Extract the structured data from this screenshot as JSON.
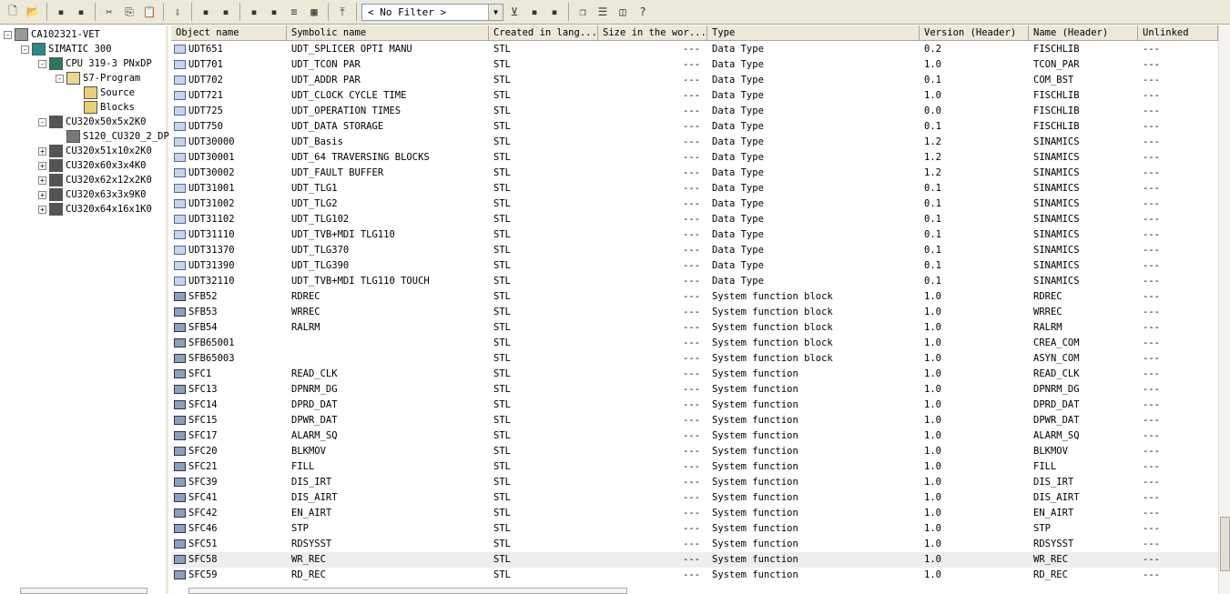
{
  "toolbar": {
    "filter_value": "< No Filter >",
    "icons": [
      "new-icon",
      "open-icon",
      "accessible-nodes-icon",
      "memory-card-icon",
      "cut-icon",
      "copy-icon",
      "paste-icon",
      "download-icon",
      "online-icon",
      "offline-icon",
      "large-icons-icon",
      "small-icons-icon",
      "list-icon",
      "details-icon",
      "up-level-icon",
      "filter-icon",
      "netpro-icon",
      "simulation-icon",
      "cascade-icon",
      "tile-horizontal-icon",
      "tile-vertical-icon",
      "help-icon"
    ]
  },
  "tree": [
    {
      "label": "CA102321-VET",
      "level": 0,
      "expander": "-",
      "icon": "project-icon"
    },
    {
      "label": "SIMATIC 300",
      "level": 1,
      "expander": "-",
      "icon": "station-icon"
    },
    {
      "label": "CPU 319-3 PNxDP",
      "level": 2,
      "expander": "-",
      "icon": "cpu-icon"
    },
    {
      "label": "S7-Program",
      "level": 3,
      "expander": "-",
      "icon": "program-folder-icon"
    },
    {
      "label": "Source",
      "level": 4,
      "expander": "",
      "icon": "source-folder-icon"
    },
    {
      "label": "Blocks",
      "level": 4,
      "expander": "",
      "icon": "blocks-folder-icon"
    },
    {
      "label": "CU320x50x5x2K0",
      "level": 2,
      "expander": "-",
      "icon": "drive-icon"
    },
    {
      "label": "S120_CU320_2_DP",
      "level": 3,
      "expander": "",
      "icon": "drive-object-icon"
    },
    {
      "label": "CU320x51x10x2K0",
      "level": 2,
      "expander": "+",
      "icon": "drive-icon"
    },
    {
      "label": "CU320x60x3x4K0",
      "level": 2,
      "expander": "+",
      "icon": "drive-icon"
    },
    {
      "label": "CU320x62x12x2K0",
      "level": 2,
      "expander": "+",
      "icon": "drive-icon"
    },
    {
      "label": "CU320x63x3x9K0",
      "level": 2,
      "expander": "+",
      "icon": "drive-icon"
    },
    {
      "label": "CU320x64x16x1K0",
      "level": 2,
      "expander": "+",
      "icon": "drive-icon"
    }
  ],
  "columns": [
    "Object name",
    "Symbolic name",
    "Created in lang...",
    "Size in the wor...",
    "Type",
    "Version (Header)",
    "Name (Header)",
    "Unlinked"
  ],
  "rows": [
    [
      "UDT651",
      "UDT_SPLICER OPTI MANU",
      "STL",
      "---",
      "Data Type",
      "0.2",
      "FISCHLIB",
      "---"
    ],
    [
      "UDT701",
      "UDT_TCON PAR",
      "STL",
      "---",
      "Data Type",
      "1.0",
      "TCON_PAR",
      "---"
    ],
    [
      "UDT702",
      "UDT_ADDR PAR",
      "STL",
      "---",
      "Data Type",
      "0.1",
      "COM_BST",
      "---"
    ],
    [
      "UDT721",
      "UDT_CLOCK CYCLE TIME",
      "STL",
      "---",
      "Data Type",
      "1.0",
      "FISCHLIB",
      "---"
    ],
    [
      "UDT725",
      "UDT_OPERATION TIMES",
      "STL",
      "---",
      "Data Type",
      "0.0",
      "FISCHLIB",
      "---"
    ],
    [
      "UDT750",
      "UDT_DATA STORAGE",
      "STL",
      "---",
      "Data Type",
      "0.1",
      "FISCHLIB",
      "---"
    ],
    [
      "UDT30000",
      "UDT_Basis",
      "STL",
      "---",
      "Data Type",
      "1.2",
      "SINAMICS",
      "---"
    ],
    [
      "UDT30001",
      "UDT_64 TRAVERSING BLOCKS",
      "STL",
      "---",
      "Data Type",
      "1.2",
      "SINAMICS",
      "---"
    ],
    [
      "UDT30002",
      "UDT_FAULT BUFFER",
      "STL",
      "---",
      "Data Type",
      "1.2",
      "SINAMICS",
      "---"
    ],
    [
      "UDT31001",
      "UDT_TLG1",
      "STL",
      "---",
      "Data Type",
      "0.1",
      "SINAMICS",
      "---"
    ],
    [
      "UDT31002",
      "UDT_TLG2",
      "STL",
      "---",
      "Data Type",
      "0.1",
      "SINAMICS",
      "---"
    ],
    [
      "UDT31102",
      "UDT_TLG102",
      "STL",
      "---",
      "Data Type",
      "0.1",
      "SINAMICS",
      "---"
    ],
    [
      "UDT31110",
      "UDT_TVB+MDI TLG110",
      "STL",
      "---",
      "Data Type",
      "0.1",
      "SINAMICS",
      "---"
    ],
    [
      "UDT31370",
      "UDT_TLG370",
      "STL",
      "---",
      "Data Type",
      "0.1",
      "SINAMICS",
      "---"
    ],
    [
      "UDT31390",
      "UDT_TLG390",
      "STL",
      "---",
      "Data Type",
      "0.1",
      "SINAMICS",
      "---"
    ],
    [
      "UDT32110",
      "UDT_TVB+MDI TLG110 TOUCH",
      "STL",
      "---",
      "Data Type",
      "0.1",
      "SINAMICS",
      "---"
    ],
    [
      "SFB52",
      "RDREC",
      "STL",
      "---",
      "System function block",
      "1.0",
      "RDREC",
      "---"
    ],
    [
      "SFB53",
      "WRREC",
      "STL",
      "---",
      "System function block",
      "1.0",
      "WRREC",
      "---"
    ],
    [
      "SFB54",
      "RALRM",
      "STL",
      "---",
      "System function block",
      "1.0",
      "RALRM",
      "---"
    ],
    [
      "SFB65001",
      "",
      "STL",
      "---",
      "System function block",
      "1.0",
      "CREA_COM",
      "---"
    ],
    [
      "SFB65003",
      "",
      "STL",
      "---",
      "System function block",
      "1.0",
      "ASYN_COM",
      "---"
    ],
    [
      "SFC1",
      "READ_CLK",
      "STL",
      "---",
      "System function",
      "1.0",
      "READ_CLK",
      "---"
    ],
    [
      "SFC13",
      "DPNRM_DG",
      "STL",
      "---",
      "System function",
      "1.0",
      "DPNRM_DG",
      "---"
    ],
    [
      "SFC14",
      "DPRD_DAT",
      "STL",
      "---",
      "System function",
      "1.0",
      "DPRD_DAT",
      "---"
    ],
    [
      "SFC15",
      "DPWR_DAT",
      "STL",
      "---",
      "System function",
      "1.0",
      "DPWR_DAT",
      "---"
    ],
    [
      "SFC17",
      "ALARM_SQ",
      "STL",
      "---",
      "System function",
      "1.0",
      "ALARM_SQ",
      "---"
    ],
    [
      "SFC20",
      "BLKMOV",
      "STL",
      "---",
      "System function",
      "1.0",
      "BLKMOV",
      "---"
    ],
    [
      "SFC21",
      "FILL",
      "STL",
      "---",
      "System function",
      "1.0",
      "FILL",
      "---"
    ],
    [
      "SFC39",
      "DIS_IRT",
      "STL",
      "---",
      "System function",
      "1.0",
      "DIS_IRT",
      "---"
    ],
    [
      "SFC41",
      "DIS_AIRT",
      "STL",
      "---",
      "System function",
      "1.0",
      "DIS_AIRT",
      "---"
    ],
    [
      "SFC42",
      "EN_AIRT",
      "STL",
      "---",
      "System function",
      "1.0",
      "EN_AIRT",
      "---"
    ],
    [
      "SFC46",
      "STP",
      "STL",
      "---",
      "System function",
      "1.0",
      "STP",
      "---"
    ],
    [
      "SFC51",
      "RDSYSST",
      "STL",
      "---",
      "System function",
      "1.0",
      "RDSYSST",
      "---"
    ],
    [
      "SFC58",
      "WR_REC",
      "STL",
      "---",
      "System function",
      "1.0",
      "WR_REC",
      "---"
    ],
    [
      "SFC59",
      "RD_REC",
      "STL",
      "---",
      "System function",
      "1.0",
      "RD_REC",
      "---"
    ]
  ],
  "selected_row": "SFC58"
}
